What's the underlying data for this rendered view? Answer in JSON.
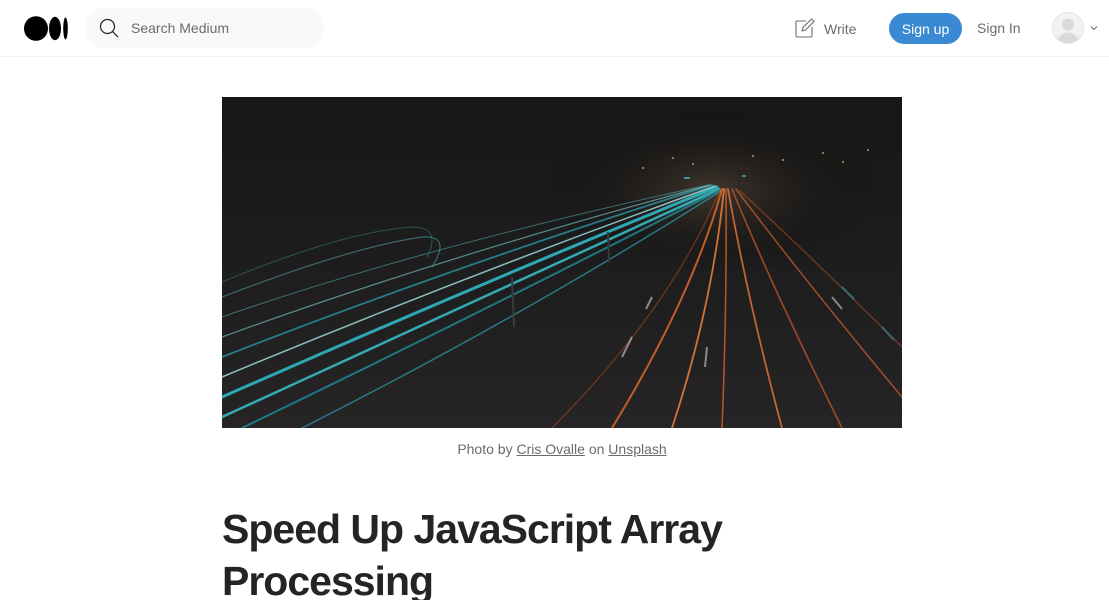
{
  "header": {
    "search": {
      "placeholder": "Search Medium"
    },
    "write_label": "Write",
    "signup_label": "Sign up",
    "signin_label": "Sign In"
  },
  "hero_image": {
    "caption": {
      "prefix": "Photo by ",
      "author": "Cris Ovalle",
      "middle": " on ",
      "source": "Unsplash"
    }
  },
  "article": {
    "title": "Speed Up JavaScript Array Processing"
  },
  "colors": {
    "accent": "#3a8ad3",
    "text": "#242424",
    "muted": "#6b6b6b"
  },
  "icons": [
    "medium-logo-icon",
    "search-icon",
    "write-icon",
    "avatar-icon",
    "chevron-down-icon"
  ]
}
